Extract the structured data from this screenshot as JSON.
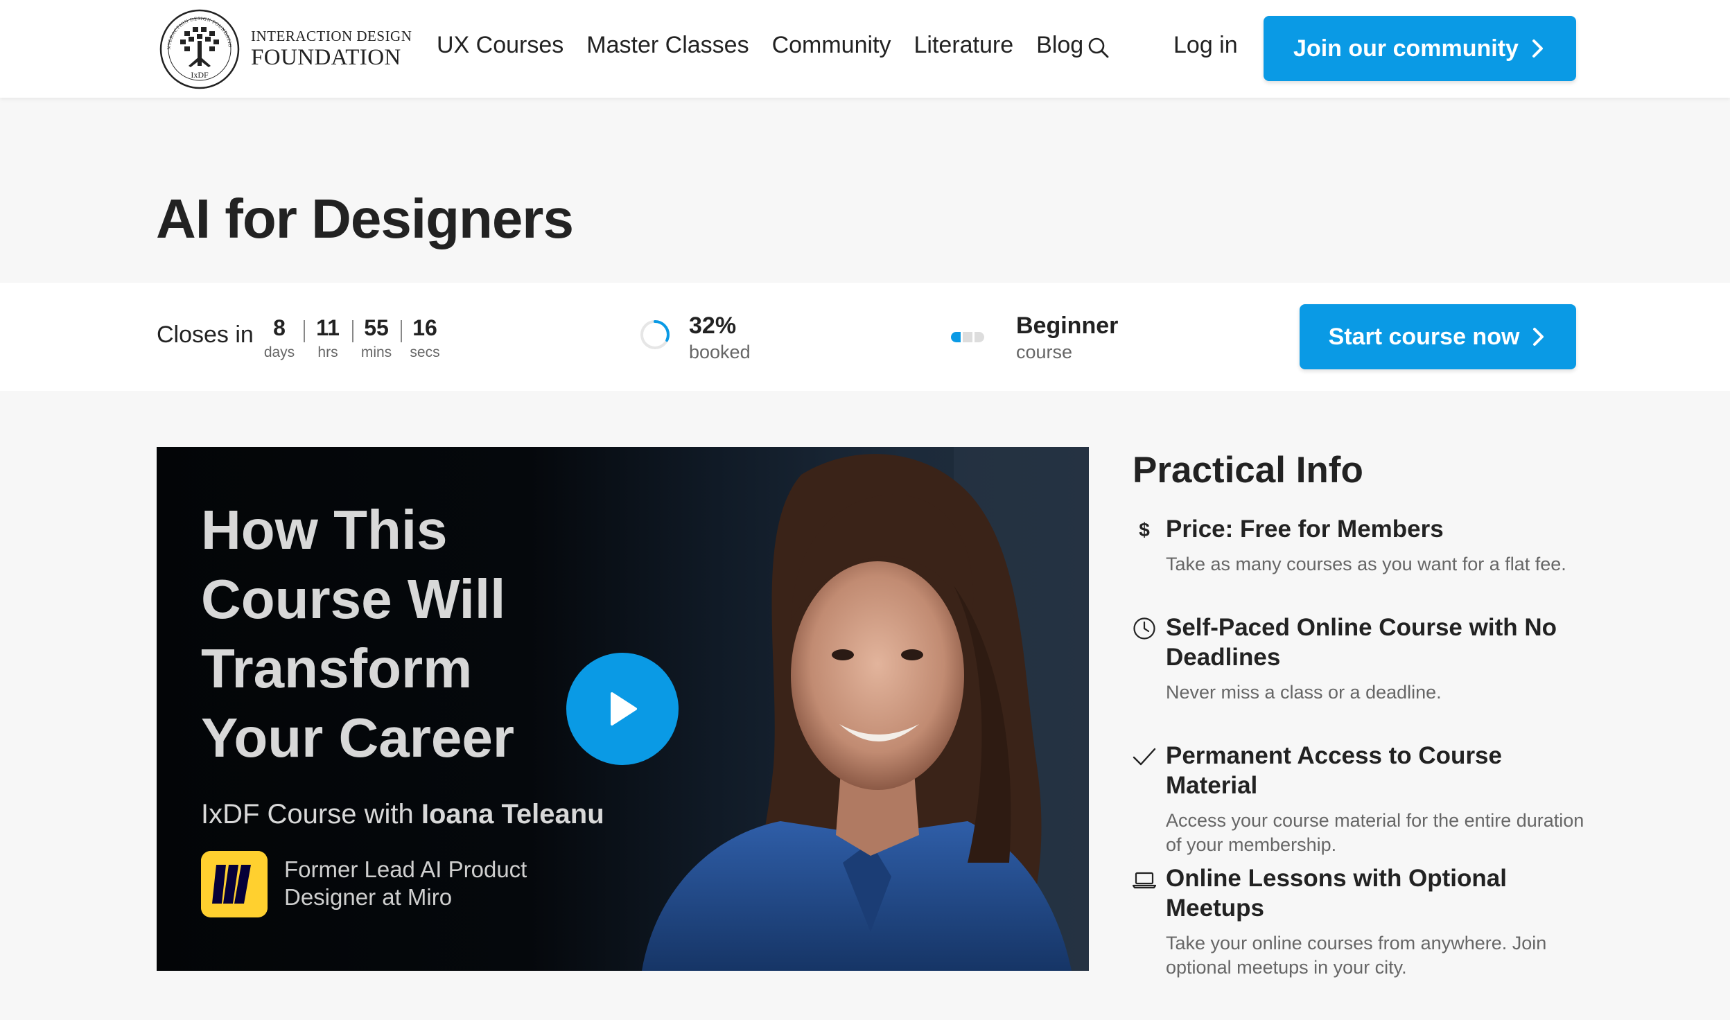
{
  "header": {
    "logo": {
      "line1": "INTERACTION DESIGN",
      "line2": "FOUNDATION",
      "seal_text": "IxDF",
      "seal_ring_text": "INTERACTION DESIGN FOUNDATION"
    },
    "nav": [
      "UX Courses",
      "Master Classes",
      "Community",
      "Literature",
      "Blog"
    ],
    "search_icon": "search-icon",
    "login_label": "Log in",
    "join_label": "Join our community"
  },
  "page": {
    "title": "AI for Designers"
  },
  "info_bar": {
    "closes_label": "Closes in",
    "countdown": [
      {
        "value": "8",
        "unit": "days"
      },
      {
        "value": "11",
        "unit": "hrs"
      },
      {
        "value": "55",
        "unit": "mins"
      },
      {
        "value": "16",
        "unit": "secs"
      }
    ],
    "booked": {
      "value": "32%",
      "label": "booked",
      "fraction": 0.32
    },
    "level": {
      "value": "Beginner",
      "label": "course",
      "filled_segments": 1,
      "total_segments": 3
    },
    "start_label": "Start course now"
  },
  "video": {
    "headline": [
      "How This",
      "Course Will",
      "Transform",
      "Your Career"
    ],
    "subtitle_prefix": "IxDF Course with ",
    "instructor": "Ioana Teleanu",
    "role": "Former Lead AI Product Designer at Miro",
    "play_icon": "play-icon"
  },
  "practical_info": {
    "title": "Practical Info",
    "items": [
      {
        "icon": "dollar-icon",
        "title": "Price: Free for Members",
        "desc": "Take as many courses as you want for a flat fee."
      },
      {
        "icon": "clock-icon",
        "title": "Self-Paced Online Course with No Deadlines",
        "desc": "Never miss a class or a deadline."
      },
      {
        "icon": "checkmark-icon",
        "title": "Permanent Access to Course Material",
        "desc": "Access your course material for the entire duration of your membership."
      },
      {
        "icon": "laptop-icon",
        "title": "Online Lessons with Optional Meetups",
        "desc": "Take your online courses from anywhere. Join optional meetups in your city."
      }
    ]
  },
  "colors": {
    "accent": "#0a9ae5",
    "text": "#222222",
    "muted": "#666666",
    "page_bg": "#f7f7f7"
  }
}
